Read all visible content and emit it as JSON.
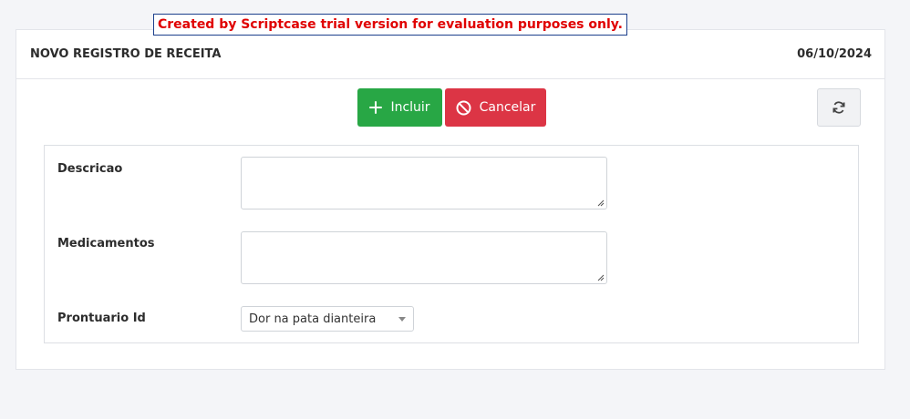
{
  "trial_banner": "Created by Scriptcase trial version for evaluation purposes only.",
  "header": {
    "title": "NOVO REGISTRO DE RECEITA",
    "date": "06/10/2024"
  },
  "toolbar": {
    "include_label": "Incluir",
    "cancel_label": "Cancelar"
  },
  "form": {
    "fields": [
      {
        "label": "Descricao",
        "value": ""
      },
      {
        "label": "Medicamentos",
        "value": ""
      },
      {
        "label": "Prontuario Id",
        "value": "Dor na pata dianteira"
      }
    ]
  },
  "colors": {
    "include_button": "#28a745",
    "cancel_button": "#dc3545",
    "trial_text": "#e00000"
  }
}
